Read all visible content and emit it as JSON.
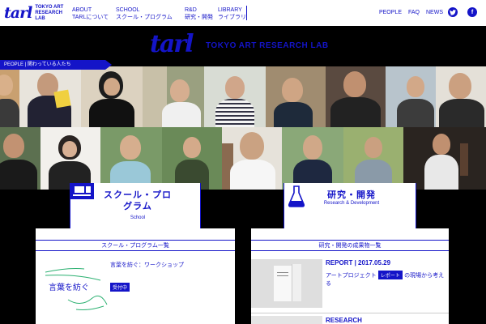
{
  "header": {
    "logo_script": "tarl",
    "logo_line1": "TOKYO ART",
    "logo_line2": "RESEARCH LAB",
    "nav": [
      {
        "en": "ABOUT",
        "jp": "TARLについて"
      },
      {
        "en": "SCHOOL",
        "jp": "スクール・プログラム"
      },
      {
        "en": "R&D",
        "jp": "研究・開発"
      },
      {
        "en": "LIBRARY",
        "jp": "ライブラリ"
      }
    ],
    "right_links": [
      "PEOPLE",
      "FAQ",
      "NEWS"
    ],
    "social": [
      "twitter-icon",
      "facebook-icon"
    ]
  },
  "banner": {
    "script": "tarl",
    "text": "TOKYO ART RESEARCH LAB"
  },
  "people": {
    "label": "PEOPLE | 関わっている人たち"
  },
  "school": {
    "title_line1": "スクール・プロ",
    "title_line2": "グラム",
    "subtitle": "School",
    "panel_heading": "スクール・プログラム一覧",
    "item_image_text": "言葉を紡ぐ",
    "item_title": "言葉を紡ぐ：ワークショップ",
    "item_tag": "受付中"
  },
  "rnd": {
    "title": "研究・開発",
    "subtitle": "Research & Development",
    "panel_heading": "研究・開発の成果物一覧",
    "report_label": "REPORT",
    "report_date": "2017.05.29",
    "report_title": "アートプロジェクト",
    "report_tag": "レポート",
    "report_title2": "の現場から考える",
    "research_label": "RESEARCH"
  },
  "colors": {
    "accent": "#1414c8",
    "background": "#000000",
    "panel": "#ffffff"
  }
}
